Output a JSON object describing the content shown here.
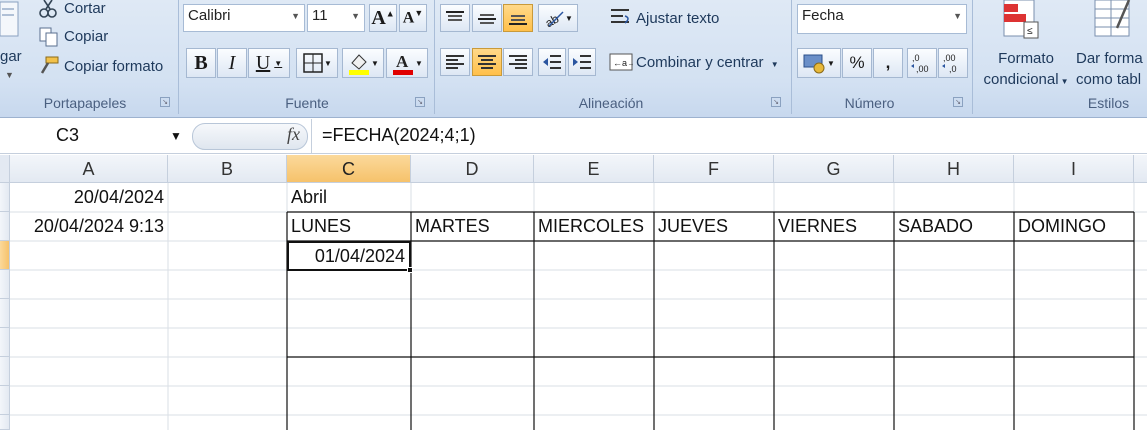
{
  "ribbon": {
    "clipboard": {
      "paste_label": "gar",
      "cut_label": "Cortar",
      "copy_label": "Copiar",
      "format_painter_label": "Copiar formato",
      "group_label": "Portapapeles"
    },
    "font": {
      "font_name": "Calibri",
      "font_size": "11",
      "bold": "B",
      "italic": "I",
      "underline": "U",
      "group_label": "Fuente"
    },
    "alignment": {
      "wrap_text_label": "Ajustar texto",
      "merge_center_label": "Combinar y centrar",
      "group_label": "Alineación"
    },
    "number": {
      "format_value": "Fecha",
      "percent": "%",
      "comma": ",",
      "inc_decimal": ",0\n,00",
      "group_label": "Número"
    },
    "styles": {
      "conditional_format_line1": "Formato",
      "conditional_format_line2": "condicional",
      "format_table_line1": "Dar forma",
      "format_table_line2": "como tabl",
      "group_label": "Estilos"
    }
  },
  "formula_bar": {
    "name_box": "C3",
    "fx": "fx",
    "formula": "=FECHA(2024;4;1)"
  },
  "columns": [
    "A",
    "B",
    "C",
    "D",
    "E",
    "F",
    "G",
    "H",
    "I"
  ],
  "selected_column": "C",
  "cells": {
    "A1": "20/04/2024",
    "A2": "20/04/2024 9:13",
    "C1": "Abril",
    "C2": "LUNES",
    "D2": "MARTES",
    "E2": "MIERCOLES",
    "F2": "JUEVES",
    "G2": "VIERNES",
    "H2": "SABADO",
    "I2": "DOMINGO",
    "C3": "01/04/2024"
  },
  "colors": {
    "selection": "#f6c26b",
    "ribbon_bg": "#d3e1f2",
    "font_color_bar": "#e00000",
    "highlight_bar": "#ffff00"
  }
}
